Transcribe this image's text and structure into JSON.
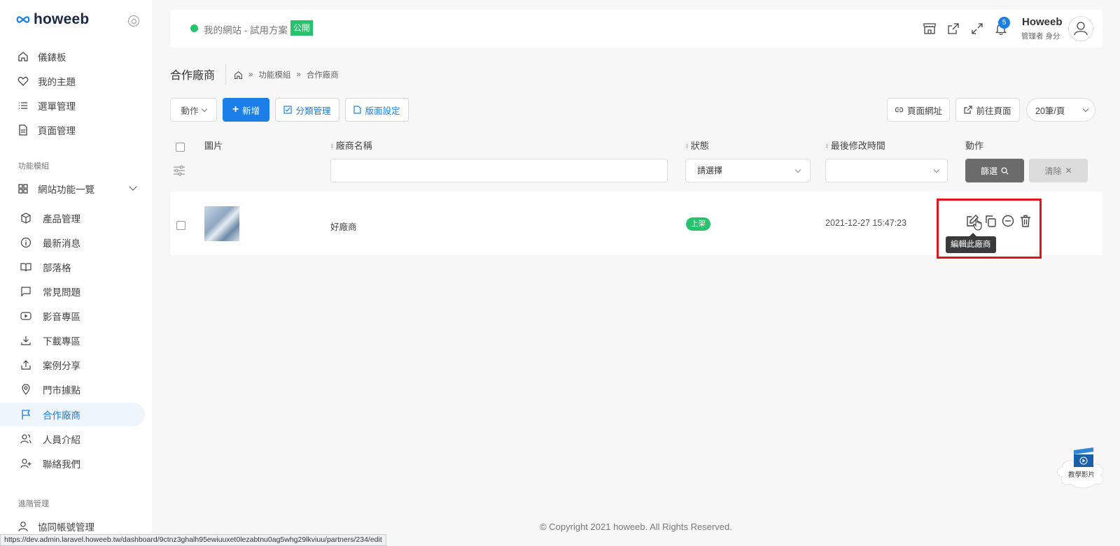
{
  "brand": {
    "logo_text": "howeeb"
  },
  "sidebar": {
    "items": [
      {
        "label": "儀錶板",
        "icon": "home-icon"
      },
      {
        "label": "我的主題",
        "icon": "heart-icon"
      },
      {
        "label": "選單管理",
        "icon": "list-icon"
      },
      {
        "label": "頁面管理",
        "icon": "document-icon"
      }
    ],
    "section_modules": "功能模組",
    "modules_group": "網站功能一覽",
    "module_items": [
      {
        "label": "產品管理",
        "icon": "box-icon"
      },
      {
        "label": "最新消息",
        "icon": "info-icon"
      },
      {
        "label": "部落格",
        "icon": "book-icon"
      },
      {
        "label": "常見問題",
        "icon": "chat-icon"
      },
      {
        "label": "影音專區",
        "icon": "video-icon"
      },
      {
        "label": "下載專區",
        "icon": "download-icon"
      },
      {
        "label": "案例分享",
        "icon": "share-icon"
      },
      {
        "label": "門市據點",
        "icon": "location-icon"
      },
      {
        "label": "合作廠商",
        "icon": "flag-icon",
        "active": true
      },
      {
        "label": "人員介紹",
        "icon": "users-icon"
      },
      {
        "label": "聯絡我們",
        "icon": "user-plus-icon"
      }
    ],
    "section_advanced": "進階管理",
    "advanced_items": [
      {
        "label": "協同帳號管理",
        "icon": "user-icon"
      }
    ]
  },
  "topbar": {
    "site_name": "我的網站 - 試用方案",
    "publish_badge": "公開",
    "notification_count": "5",
    "user_name": "Howeeb",
    "user_role": "管理者 身分"
  },
  "page": {
    "title": "合作廠商",
    "breadcrumb": [
      "功能模組",
      "合作廠商"
    ]
  },
  "toolbar": {
    "action_label": "動作",
    "add_label": "新增",
    "category_label": "分類管理",
    "layout_label": "版面設定",
    "page_url_label": "頁面網址",
    "go_page_label": "前往頁面",
    "per_page": "20筆/頁"
  },
  "table": {
    "headers": {
      "image": "圖片",
      "name": "廠商名稱",
      "status": "狀態",
      "modified": "最後修改時間",
      "actions": "動作"
    },
    "filter": {
      "status_placeholder": "請選擇",
      "filter_btn": "篩選",
      "clear_btn": "清除"
    },
    "rows": [
      {
        "name": "好廠商",
        "status": "上架",
        "modified": "2021-12-27 15:47:23"
      }
    ],
    "tooltip": "編輯此廠商"
  },
  "footer": {
    "copyright": "© Copyright 2021 howeeb. All Rights Reserved."
  },
  "status_url": "https://dev.admin.laravel.howeeb.tw/dashboard/9ctnz3ghalh95ewiuuxet0lezabtnu0ag5whg29lkviuu/partners/234/edit",
  "tutorial": {
    "label": "教學影片"
  },
  "colors": {
    "accent": "#1a7fe8",
    "success": "#27c26c",
    "highlight": "#e0141e"
  }
}
